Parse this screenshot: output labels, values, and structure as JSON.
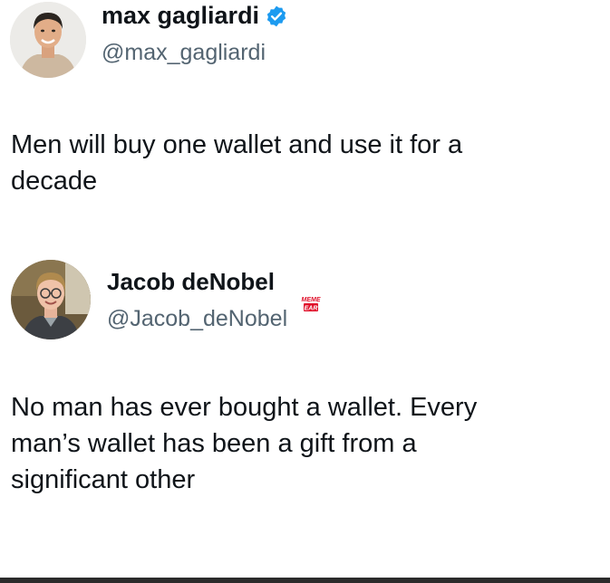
{
  "tweets": [
    {
      "display_name": "max gagliardi",
      "handle": "@max_gagliardi",
      "verified": true,
      "verified_color": "#1d9bf0",
      "text": "Men will buy one wallet and use it for a\ndecade"
    },
    {
      "display_name": "Jacob deNobel",
      "handle": "@Jacob_deNobel",
      "verified": false,
      "text": "No man has ever bought a wallet. Every\nman’s wallet has been a gift from a\nsignificant other"
    }
  ],
  "watermark": {
    "line1": "MEME",
    "line2": "EAR",
    "color": "#e0102a"
  }
}
